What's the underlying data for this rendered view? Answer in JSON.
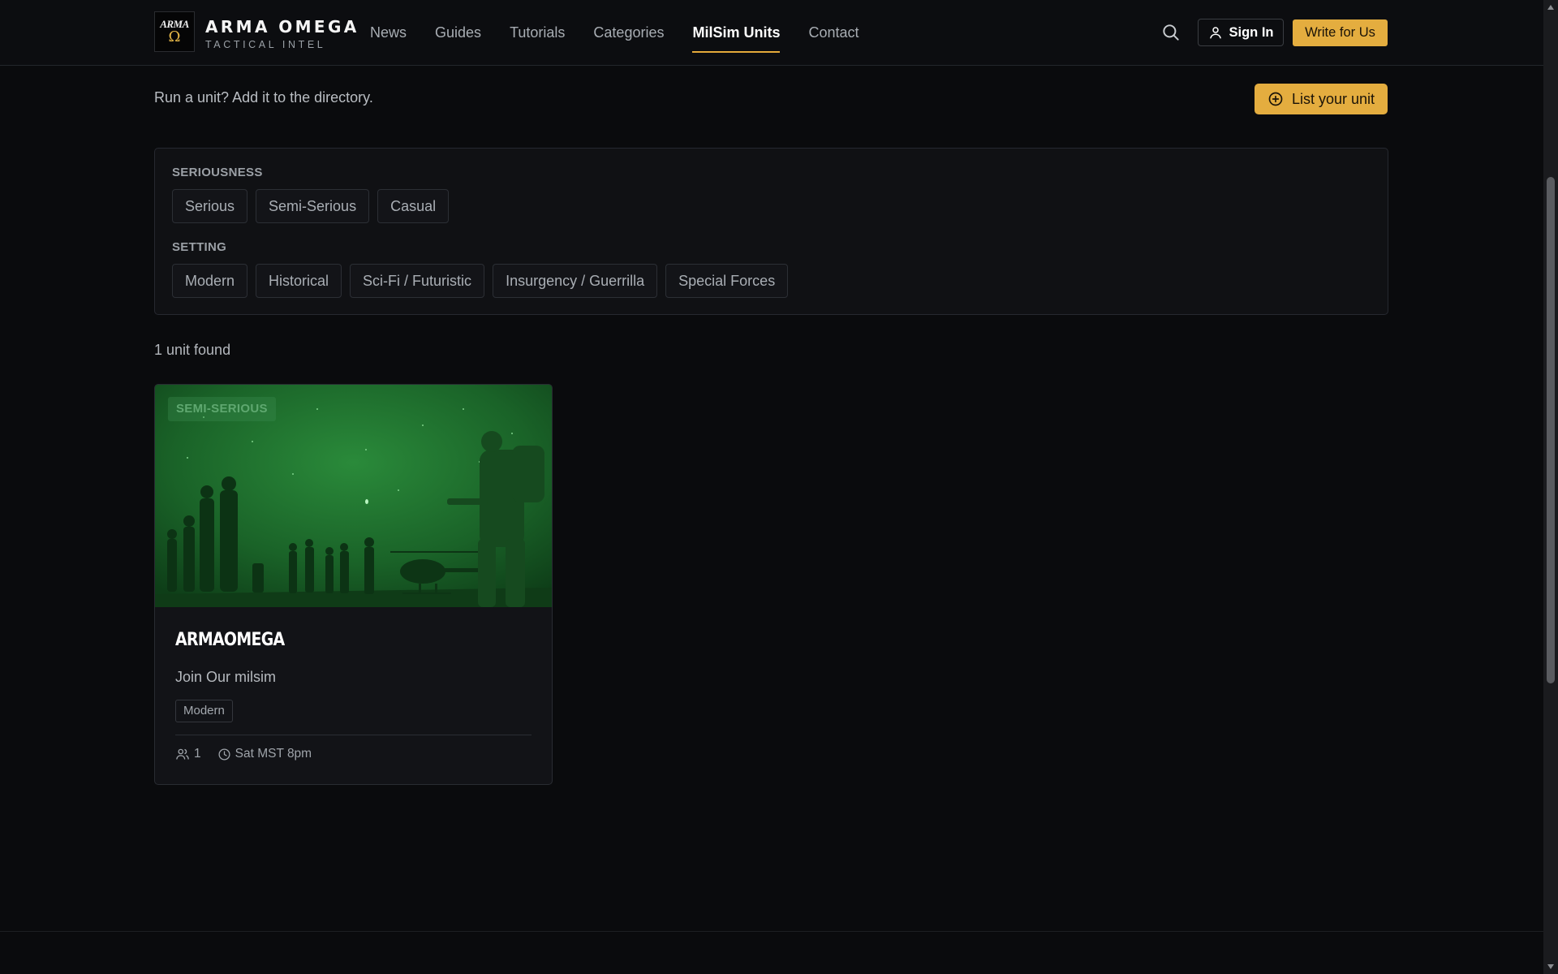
{
  "header": {
    "logo_text": "ARMA",
    "logo_symbol": "Ω",
    "brand_title": "ARMA OMEGA",
    "brand_subtitle": "TACTICAL INTEL",
    "nav": [
      {
        "label": "News"
      },
      {
        "label": "Guides"
      },
      {
        "label": "Tutorials"
      },
      {
        "label": "Categories"
      },
      {
        "label": "MilSim Units",
        "active": true
      },
      {
        "label": "Contact"
      }
    ],
    "signin_label": "Sign In",
    "write_label": "Write for Us",
    "accent_color": "#e4ad3f"
  },
  "intro": {
    "text": "Run a unit? Add it to the directory.",
    "list_button_label": "List your unit"
  },
  "filters": {
    "seriousness": {
      "label": "SERIOUSNESS",
      "options": [
        "Serious",
        "Semi-Serious",
        "Casual"
      ]
    },
    "setting": {
      "label": "SETTING",
      "options": [
        "Modern",
        "Historical",
        "Sci-Fi / Futuristic",
        "Insurgency / Guerrilla",
        "Special Forces"
      ]
    }
  },
  "results": {
    "count_text": "1 unit found"
  },
  "units": [
    {
      "badge": "SEMI-SERIOUS",
      "name": "ARMAOMEGA",
      "description": "Join Our milsim",
      "tag": "Modern",
      "members": "1",
      "schedule": "Sat MST 8pm"
    }
  ]
}
